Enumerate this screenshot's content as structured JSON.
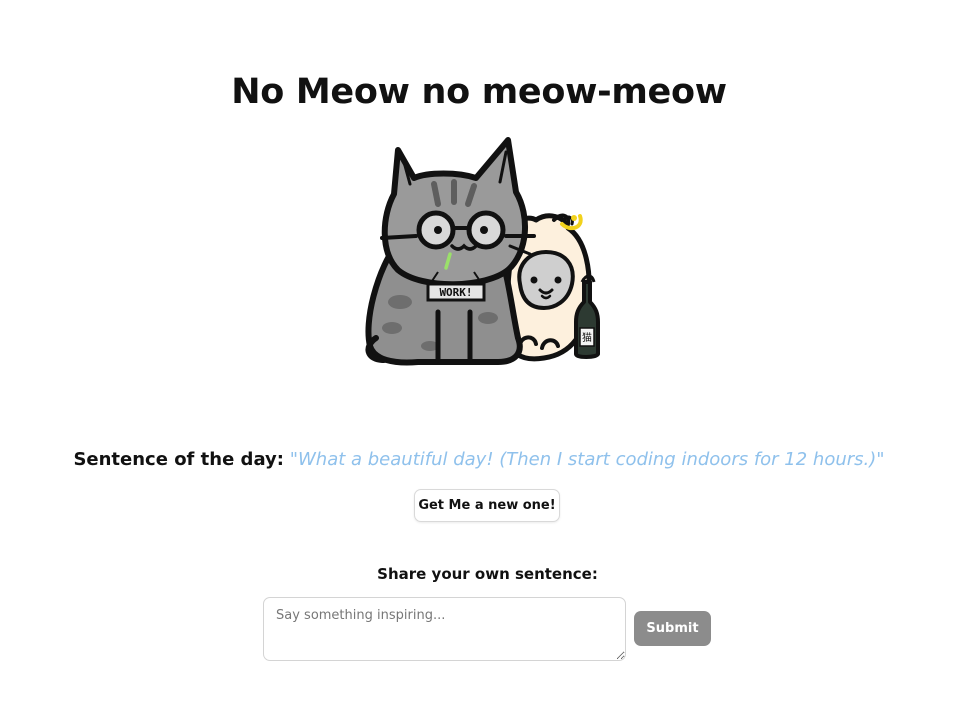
{
  "header": {
    "title": "No Meow no meow-meow"
  },
  "illustration": {
    "description_icon": "cats-illustration",
    "sign_text": "WORK!",
    "bottle_label": "猫"
  },
  "daily": {
    "label": "Sentence of the day:",
    "quote": "\"What a beautiful day! (Then I start coding indoors for 12 hours.)\"",
    "new_button": "Get Me a new one!"
  },
  "share": {
    "label": "Share your own sentence:",
    "placeholder": "Say something inspiring...",
    "value": "",
    "submit": "Submit"
  },
  "colors": {
    "quote": "#8fc1ec",
    "submit_bg": "#8c8c8c"
  }
}
